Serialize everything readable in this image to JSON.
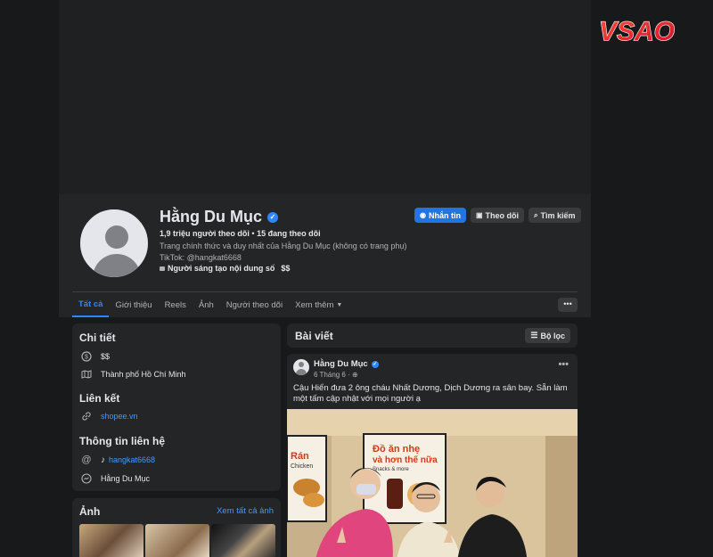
{
  "brand": {
    "logo_text": "VSAO"
  },
  "profile": {
    "name": "Hằng Du Mục",
    "followers": "1,9 triệu người theo dõi",
    "separator": " • ",
    "following": "15 đang theo dõi",
    "bio_line1": "Trang chính thức và duy nhất của Hằng Du Mục (không có trang phụ)",
    "bio_line2": "TikTok: @hangkat6668",
    "creator_badge": "Người sáng tạo nội dung số",
    "price": "$$"
  },
  "actions": {
    "message": "Nhắn tin",
    "follow": "Theo dõi",
    "search": "Tìm kiếm"
  },
  "tabs": [
    {
      "label": "Tất cả"
    },
    {
      "label": "Giới thiệu"
    },
    {
      "label": "Reels"
    },
    {
      "label": "Ảnh"
    },
    {
      "label": "Người theo dõi"
    },
    {
      "label": "Xem thêm"
    }
  ],
  "more_label": "•••",
  "details": {
    "title": "Chi tiết",
    "price": "$$",
    "location": "Thành phố Hồ Chí Minh",
    "links_title": "Liên kết",
    "website": "shopee.vn",
    "contact_title": "Thông tin liên hệ",
    "tiktok": "hangkat6668",
    "messenger": "Hằng Du Mục"
  },
  "photos": {
    "title": "Ảnh",
    "see_all": "Xem tất cả ảnh"
  },
  "posts": {
    "title": "Bài viết",
    "filter": "Bộ lọc",
    "post": {
      "author": "Hằng Du Mục",
      "date": "6 Tháng 6",
      "text": "Cậu Hiển đưa 2 ông cháu Nhất Dương, Dịch Dương ra sân bay. Sẵn làm một tấm cập nhật với mọi người ạ",
      "image_text_1": "Rán",
      "image_text_2": "Chicken",
      "image_text_3": "Đồ ăn nhẹ",
      "image_text_4": "và hơn thế nữa",
      "image_text_5": "Snacks & more"
    }
  },
  "colors": {
    "accent": "#2d88ff",
    "primary_button": "#2374e1",
    "background": "#18191a",
    "card": "#242526"
  }
}
